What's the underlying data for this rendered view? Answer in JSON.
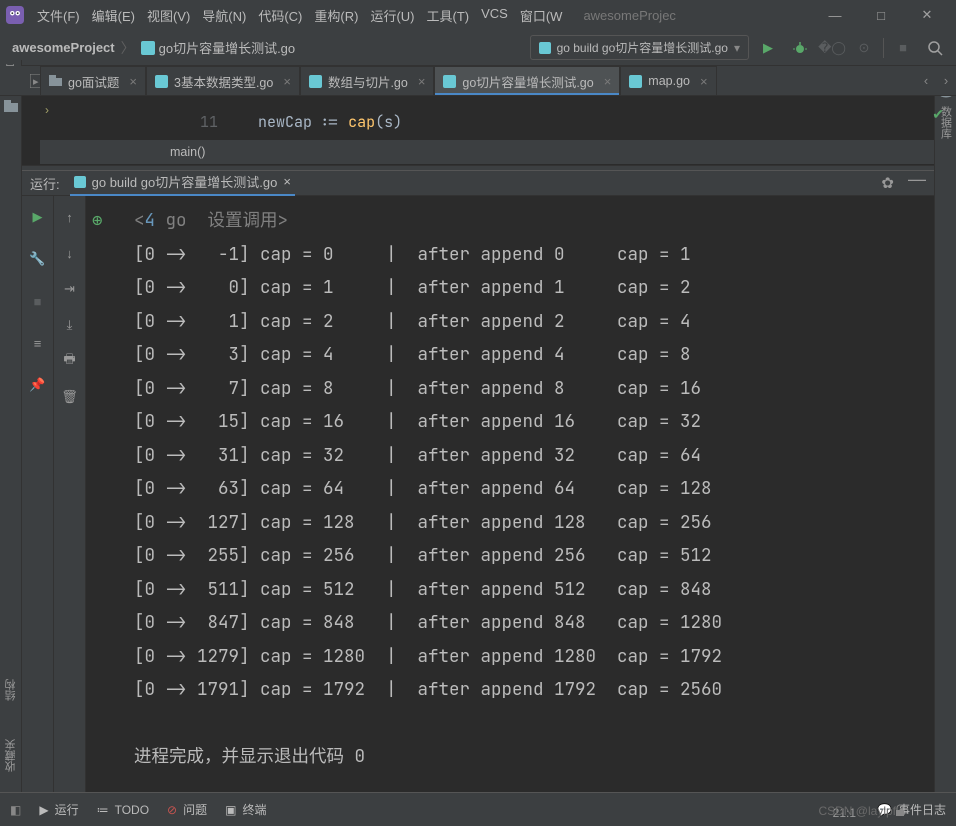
{
  "title": "awesomeProjec",
  "menu": [
    "文件(F)",
    "编辑(E)",
    "视图(V)",
    "导航(N)",
    "代码(C)",
    "重构(R)",
    "运行(U)",
    "工具(T)",
    "VCS",
    "窗口(W"
  ],
  "breadcrumb": {
    "project": "awesomeProject",
    "file": "go切片容量增长测试.go"
  },
  "run_config_label": "go build go切片容量增长测试.go",
  "tabs": [
    {
      "label": "go面试题",
      "icon": "folder"
    },
    {
      "label": "3基本数据类型.go",
      "icon": "go"
    },
    {
      "label": "数组与切片.go",
      "icon": "go"
    },
    {
      "label": "go切片容量增长测试.go",
      "icon": "go",
      "active": true
    },
    {
      "label": "map.go",
      "icon": "go"
    }
  ],
  "editor": {
    "line_no": "11",
    "snippet_id": "newCap",
    "snippet_op": ":=",
    "snippet_fn": "cap",
    "snippet_tail": "(s)",
    "crumb": "main()"
  },
  "run_panel": {
    "label": "运行:",
    "config": "go build go切片容量增长测试.go",
    "header": "<4 go  设置调用>",
    "rows": [
      {
        "a": 0,
        "b": -1,
        "cap0": 0,
        "after": 0,
        "cap1": 1
      },
      {
        "a": 0,
        "b": 0,
        "cap0": 1,
        "after": 1,
        "cap1": 2
      },
      {
        "a": 0,
        "b": 1,
        "cap0": 2,
        "after": 2,
        "cap1": 4
      },
      {
        "a": 0,
        "b": 3,
        "cap0": 4,
        "after": 4,
        "cap1": 8
      },
      {
        "a": 0,
        "b": 7,
        "cap0": 8,
        "after": 8,
        "cap1": 16
      },
      {
        "a": 0,
        "b": 15,
        "cap0": 16,
        "after": 16,
        "cap1": 32
      },
      {
        "a": 0,
        "b": 31,
        "cap0": 32,
        "after": 32,
        "cap1": 64
      },
      {
        "a": 0,
        "b": 63,
        "cap0": 64,
        "after": 64,
        "cap1": 128
      },
      {
        "a": 0,
        "b": 127,
        "cap0": 128,
        "after": 128,
        "cap1": 256
      },
      {
        "a": 0,
        "b": 255,
        "cap0": 256,
        "after": 256,
        "cap1": 512
      },
      {
        "a": 0,
        "b": 511,
        "cap0": 512,
        "after": 512,
        "cap1": 848
      },
      {
        "a": 0,
        "b": 847,
        "cap0": 848,
        "after": 848,
        "cap1": 1280
      },
      {
        "a": 0,
        "b": 1279,
        "cap0": 1280,
        "after": 1280,
        "cap1": 1792
      },
      {
        "a": 0,
        "b": 1791,
        "cap0": 1792,
        "after": 1792,
        "cap1": 2560
      }
    ],
    "exit": "进程完成，并显示退出代码 0"
  },
  "left_tools": [
    "项目"
  ],
  "left_tools2": [
    "结构",
    "收藏夹"
  ],
  "right_tools": [
    "数据库"
  ],
  "footer": {
    "run": "运行",
    "todo": "TODO",
    "problems": "问题",
    "terminal": "终端",
    "events": "事件日志",
    "pos": "21:1"
  },
  "watermark": "CSDN @laylpf"
}
